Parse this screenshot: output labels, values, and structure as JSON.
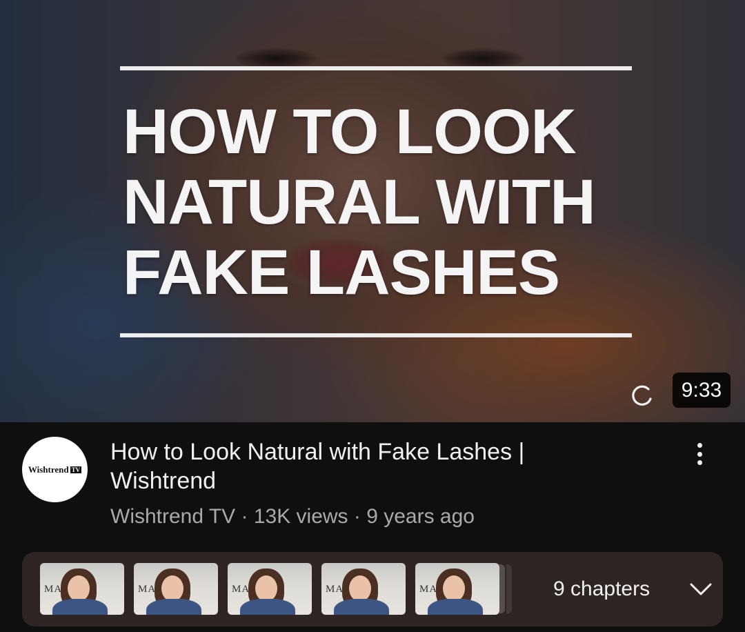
{
  "thumbnail": {
    "title_lines": [
      "HOW TO LOOK",
      "NATURAL WITH",
      "FAKE LASHES"
    ],
    "duration": "9:33",
    "loading_icon": "loading-spinner-icon"
  },
  "channel": {
    "avatar_text": "Wishtrend",
    "avatar_badge": "TV"
  },
  "video": {
    "title": "How to Look Natural with Fake Lashes | Wishtrend",
    "meta": "Wishtrend TV · 13K views · 9 years ago",
    "more_icon": "more-vert-icon"
  },
  "chapters": {
    "label": "9 chapters",
    "chevron_icon": "chevron-down-icon",
    "thumbnails": [
      {
        "text": "MA WIS"
      },
      {
        "text": "MA WISH"
      },
      {
        "text": "MA WISH"
      },
      {
        "text": "MA WISH"
      },
      {
        "text": "MA WISH"
      }
    ]
  },
  "colors": {
    "background": "#0f0f0f",
    "chapters_bg": "#2e2421",
    "text_primary": "#f1f1f1",
    "text_secondary": "#aaaaaa"
  }
}
